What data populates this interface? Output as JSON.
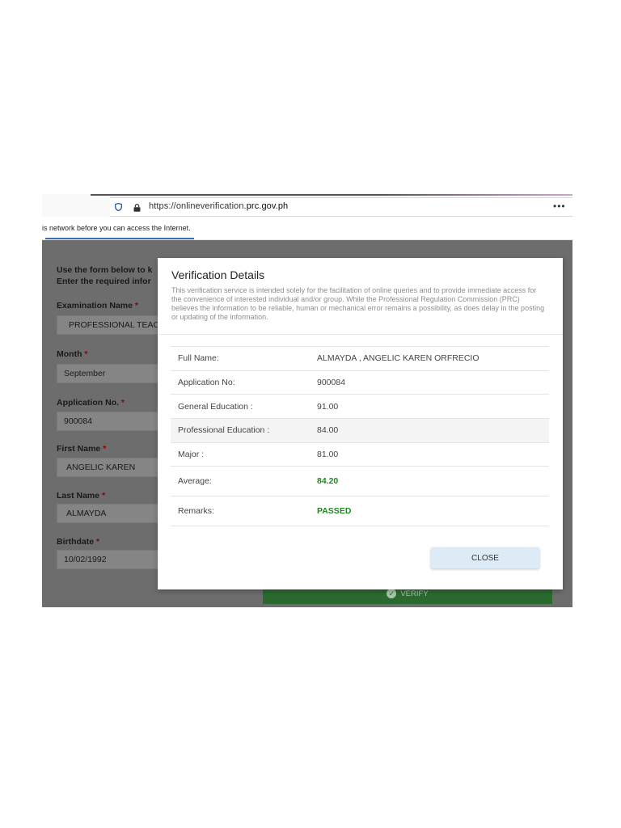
{
  "browser": {
    "url_prefix": "https://onlineverification.",
    "url_domain": "prc.gov.ph",
    "more_label": "•••"
  },
  "notice": {
    "text": "is network before you can access the Internet."
  },
  "form": {
    "intro_line1": "Use the form below to k",
    "intro_line2": "Enter the required infor",
    "required_mark": "*",
    "fields": [
      {
        "label": "Examination Name",
        "value": "PROFESSIONAL TEAC"
      },
      {
        "label": "Month",
        "value": "September"
      },
      {
        "label": "Application No.",
        "value": "900084"
      },
      {
        "label": "First Name",
        "value": "ANGELIC KAREN"
      },
      {
        "label": "Last Name",
        "value": "ALMAYDA"
      },
      {
        "label": "Birthdate",
        "value": "10/02/1992"
      }
    ],
    "verify_label": "VERIFY"
  },
  "modal": {
    "title": "Verification Details",
    "description": "This verification service is intended solely for the facilitation of online queries and to provide immediate access for the convenience of interested individual and/or group. While the Professional Regulation Commission (PRC) believes the information to be reliable, human or mechanical error remains a possibility, as does delay in the posting or updating of the information.",
    "rows": [
      {
        "label": "Full Name:",
        "value": "ALMAYDA , ANGELIC KAREN ORFRECIO"
      },
      {
        "label": "Application No:",
        "value": "900084"
      },
      {
        "label": "General Education :",
        "value": "91.00"
      },
      {
        "label": "Professional Education :",
        "value": "84.00"
      },
      {
        "label": "Major :",
        "value": "81.00"
      },
      {
        "label": "Average:",
        "value": "84.20"
      },
      {
        "label": "Remarks:",
        "value": "PASSED"
      }
    ],
    "close_label": "CLOSE"
  },
  "colors": {
    "accent_green": "#1d8a1d",
    "verify_green": "#2b6a2f",
    "close_button_bg": "#dcebf5",
    "required_red": "#8a0000"
  }
}
